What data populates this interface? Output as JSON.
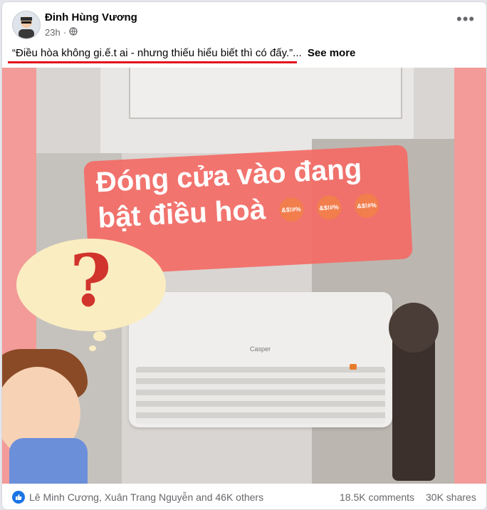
{
  "post": {
    "author": "Đinh Hùng Vương",
    "time": "23h",
    "dot": "·",
    "audience_icon": "globe-icon",
    "more_icon": "more-options-icon",
    "caption": "“Điều hòa không gi.ế.t ai - nhưng thiếu hiểu biết thì có đấy.”...",
    "see_more": "See more",
    "underline_color": "#e2121a"
  },
  "image": {
    "banner_line1": "Đóng cửa vào đang",
    "banner_line2": "bật điều hoà",
    "emoji_text": "&$!#%",
    "question_mark": "?",
    "ac_brand": "Casper"
  },
  "footer": {
    "reaction_icon": "like-icon",
    "reactors": "Lê Minh Cương, Xuân Trang Nguyễn and 46K others",
    "comments": "18.5K comments",
    "shares": "30K shares",
    "accent_color": "#1b74e4"
  }
}
